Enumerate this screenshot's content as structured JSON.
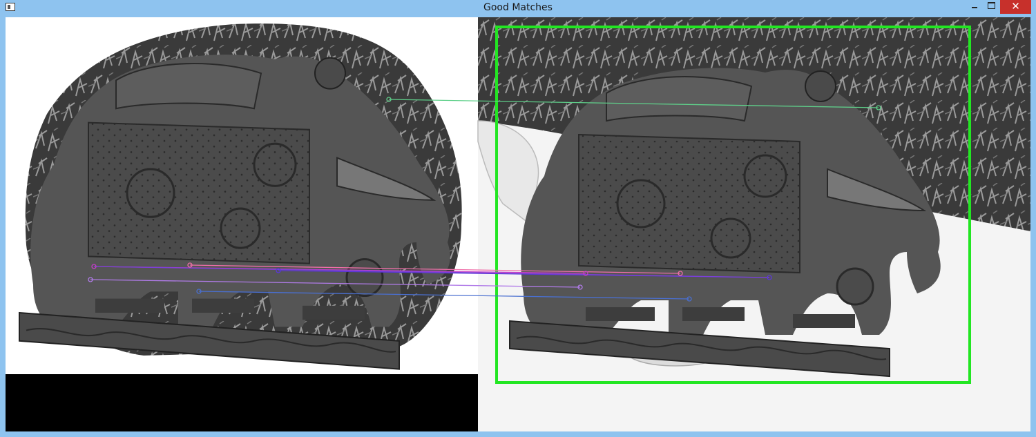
{
  "window": {
    "title": "Good Matches",
    "close_glyph": "✕"
  },
  "icons": {
    "app": "app-window-icon",
    "minimize": "minimize-icon",
    "maximize": "maximize-icon",
    "close": "close-icon"
  },
  "colors": {
    "titlebar": "#8ec3ef",
    "close_button": "#c7302b",
    "bounding_box": "#22e622",
    "match_green": "#5fd08a",
    "match_magenta": "#c73fc7",
    "match_pink": "#ef6fa9",
    "match_violet": "#5b37d8",
    "match_blue": "#4a6fd0",
    "match_lavender": "#b07be8"
  }
}
